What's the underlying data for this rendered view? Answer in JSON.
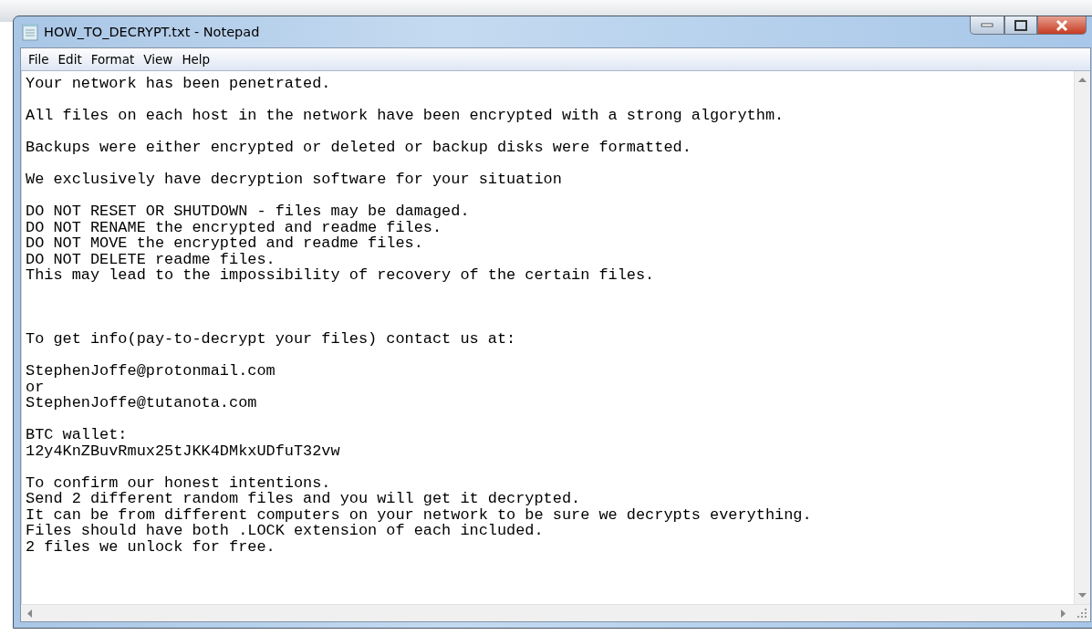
{
  "window": {
    "title": "HOW_TO_DECRYPT.txt - Notepad"
  },
  "menu": [
    "File",
    "Edit",
    "Format",
    "View",
    "Help"
  ],
  "document": {
    "paragraphs": [
      {
        "kind": "normal",
        "lines": [
          "Your network has been penetrated."
        ]
      },
      {
        "kind": "normal",
        "lines": [
          "All files on each host in the network have been encrypted with a strong algorythm."
        ]
      },
      {
        "kind": "normal",
        "lines": [
          "Backups were either encrypted or deleted or backup disks were formatted."
        ]
      },
      {
        "kind": "normal",
        "lines": [
          "We exclusively have decryption software for your situation"
        ]
      },
      {
        "kind": "normal",
        "lines": [
          "DO NOT RESET OR SHUTDOWN - files may be damaged.",
          "DO NOT RENAME the encrypted and readme files.",
          "DO NOT MOVE the encrypted and readme files.",
          "DO NOT DELETE readme files.",
          "This may lead to the impossibility of recovery of the certain files."
        ]
      },
      {
        "kind": "section",
        "lines": [
          "To get info(pay-to-decrypt your files) contact us at:"
        ]
      },
      {
        "kind": "normal",
        "lines": [
          "StephenJoffe@protonmail.com",
          "or",
          "StephenJoffe@tutanota.com"
        ]
      },
      {
        "kind": "normal",
        "lines": [
          "BTC wallet:",
          "12y4KnZBuvRmux25tJKK4DMkxUDfuT32vw"
        ]
      },
      {
        "kind": "normal",
        "lines": [
          "To confirm our honest intentions.",
          "Send 2 different random files and you will get it decrypted.",
          "It can be from different computers on your network to be sure we decrypts everything.",
          "Files should have both .LOCK extension of each included.",
          "2 files we unlock for free."
        ]
      }
    ]
  }
}
